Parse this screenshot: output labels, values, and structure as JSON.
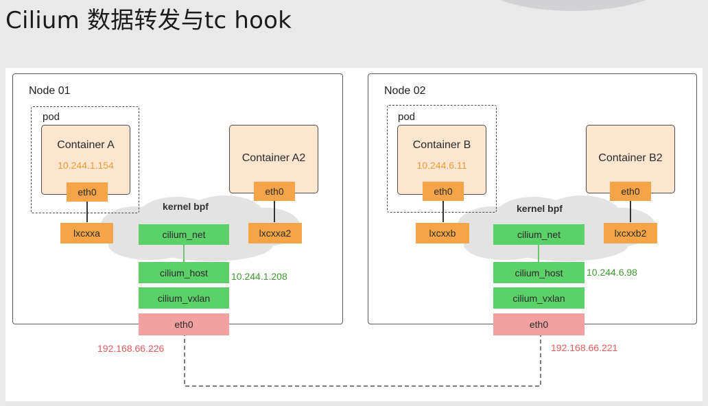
{
  "title": "Cilium 数据转发与tc hook",
  "kernel_label": "kernel bpf",
  "nodes": [
    {
      "name": "Node 01",
      "pod_label": "pod",
      "container": {
        "name": "Container A",
        "ip": "10.244.1.154",
        "eth": "eth0",
        "lxc": "lxcxxa"
      },
      "container2": {
        "name": "Container A2",
        "eth": "eth0",
        "lxc": "lxcxxa2"
      },
      "cilium_net": "cilium_net",
      "cilium_host": "cilium_host",
      "cilium_host_ip": "10.244.1.208",
      "cilium_vxlan": "cilium_vxlan",
      "host_eth": "eth0",
      "host_ip": "192.168.66.226"
    },
    {
      "name": "Node 02",
      "pod_label": "pod",
      "container": {
        "name": "Container B",
        "ip": "10.244.6.11",
        "eth": "eth0",
        "lxc": "lxcxxb"
      },
      "container2": {
        "name": "Container B2",
        "eth": "eth0",
        "lxc": "lxcxxb2"
      },
      "cilium_net": "cilium_net",
      "cilium_host": "cilium_host",
      "cilium_host_ip": "10.244.6.98",
      "cilium_vxlan": "cilium_vxlan",
      "host_eth": "eth0",
      "host_ip": "192.168.66.221"
    }
  ],
  "colors": {
    "container_fill": "#fde6cf",
    "iface_orange": "#f5a447",
    "iface_green": "#5cd069",
    "iface_pink": "#f2a0a0",
    "ip_orange": "#f19a3a",
    "ip_green": "#3e9a2e",
    "ip_red": "#e25b5b",
    "cloud_gray": "#e3e3e3"
  }
}
